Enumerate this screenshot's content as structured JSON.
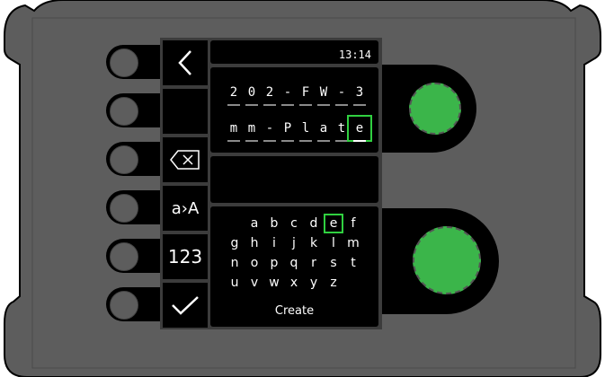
{
  "status": {
    "time": "13:14"
  },
  "name_line1": [
    "2",
    "0",
    "2",
    "-",
    "F",
    "W",
    "-",
    "3"
  ],
  "name_line2": [
    "m",
    "m",
    "-",
    "P",
    "l",
    "a",
    "t",
    "e"
  ],
  "sidebar": {
    "back_icon": "chevron-left-icon",
    "delete_icon": "backspace-icon",
    "case_toggle_label": "a›A",
    "numeric_label": "123",
    "confirm_icon": "checkmark-icon"
  },
  "keyboard": {
    "rows": [
      [
        "",
        "a",
        "b",
        "c",
        "d",
        "e",
        "f"
      ],
      [
        "g",
        "h",
        "i",
        "j",
        "k",
        "l",
        "m"
      ],
      [
        "n",
        "o",
        "p",
        "q",
        "r",
        "s",
        "t"
      ],
      [
        "u",
        "v",
        "w",
        "x",
        "y",
        "z",
        ""
      ]
    ],
    "selected_key": "e",
    "create_label": "Create"
  },
  "colors": {
    "accent": "#30d040",
    "knob": "#3bb54a",
    "body": "#5d5d5d"
  }
}
